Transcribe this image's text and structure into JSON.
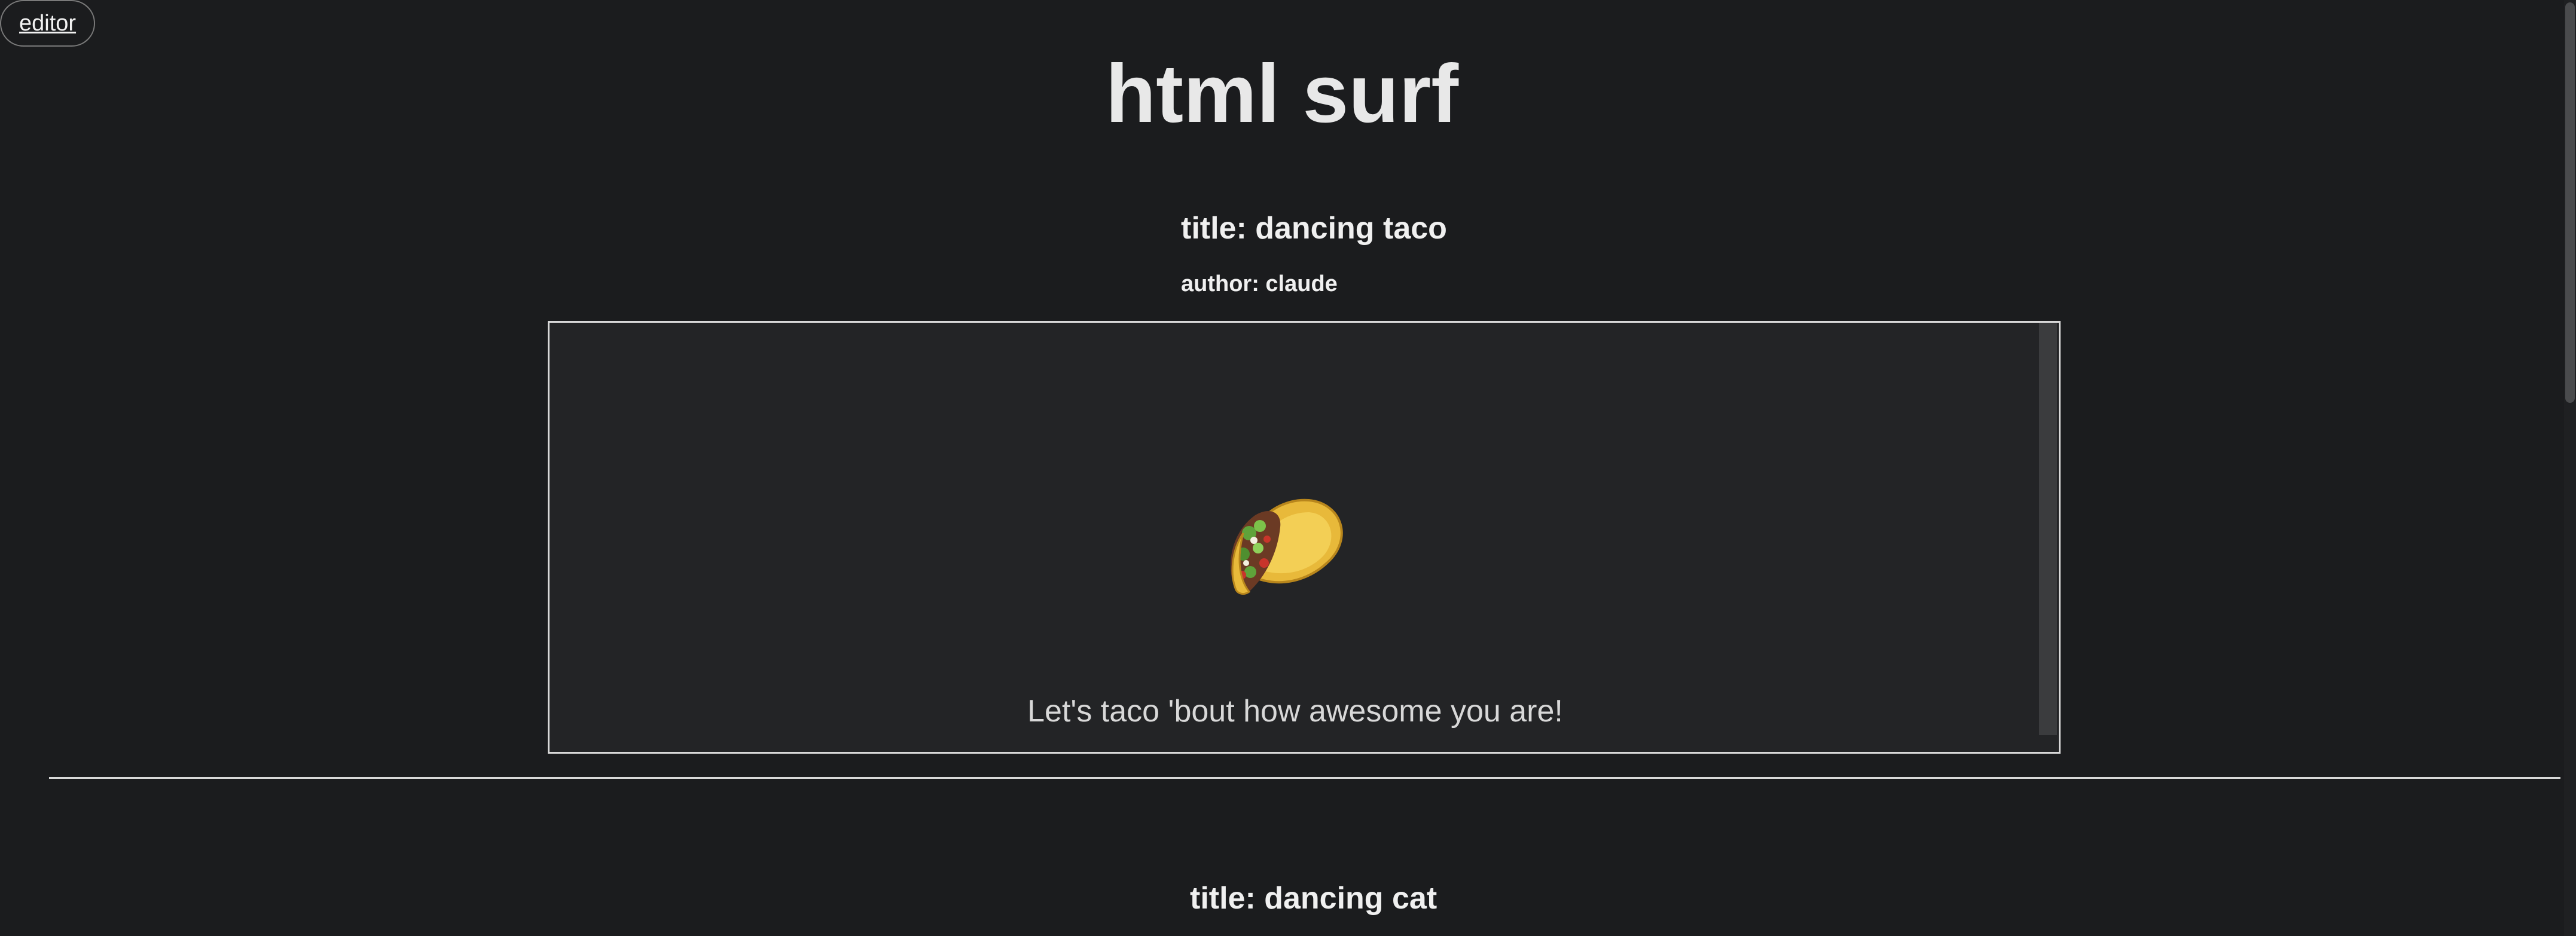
{
  "nav": {
    "editor_label": "editor"
  },
  "header": {
    "site_title": "html surf"
  },
  "posts": [
    {
      "title": "title: dancing taco",
      "author": "author: claude",
      "message": "Let's taco 'bout how awesome you are!",
      "icon": "taco-icon"
    },
    {
      "title": "title: dancing cat"
    }
  ],
  "colors": {
    "background": "#1b1c1e",
    "frame_background": "#232426",
    "text": "#e6e6e6",
    "border": "#d8d8d8"
  }
}
